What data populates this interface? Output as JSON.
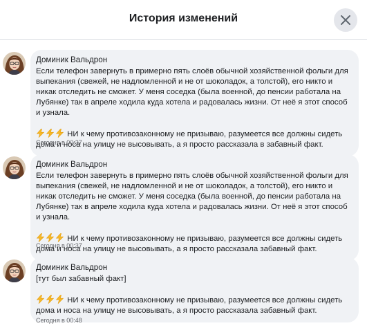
{
  "header": {
    "title": "История изменений",
    "close_icon": "close-icon"
  },
  "emoji": "zap-emoji",
  "colors": {
    "bubble": "#f0f2f5",
    "emoji": "#f7b928"
  },
  "entries": [
    {
      "author": "Доминик Вальдрон",
      "text": "Если телефон завернуть в примерно пять слоёв обычной хозяйственной фольги для выпекания (свежей, не надломленной и не от шоколадок, а толстой), его никто и никак отследить не сможет. У меня соседка (была военной, до пенсии работала на Лубянке) так в апреле ходила куда хотела и радовалась жизни. От неё я этот способ и узнала.",
      "note": "НИ к чему противозаконному не призываю, разумеется все должны сидеть дома и носа на улицу не высовывать, а я просто рассказала в забавный факт.",
      "time": "Сегодня в 00:37"
    },
    {
      "author": "Доминик Вальдрон",
      "text": "Если телефон завернуть в примерно пять слоёв обычной хозяйственной фольги для выпекания (свежей, не надломленной и не от шоколадок, а толстой), его никто и никак отследить не сможет. У меня соседка (была военной, до пенсии работала на Лубянке) так в апреле ходила куда хотела и радовалась жизни. От неё я этот способ и узнала.",
      "note": "НИ к чему противозаконному не призываю, разумеется все должны сидеть дома и носа на улицу не высовывать, а я просто рассказала забавный факт.",
      "time": "Сегодня в 00:37"
    },
    {
      "author": "Доминик Вальдрон",
      "text": "[тут был забавный факт]",
      "note": "НИ к чему противозаконному не призываю, разумеется все должны сидеть дома и носа на улицу не высовывать, а я просто рассказала забавный факт.",
      "time": "Сегодня в 00:48"
    }
  ]
}
